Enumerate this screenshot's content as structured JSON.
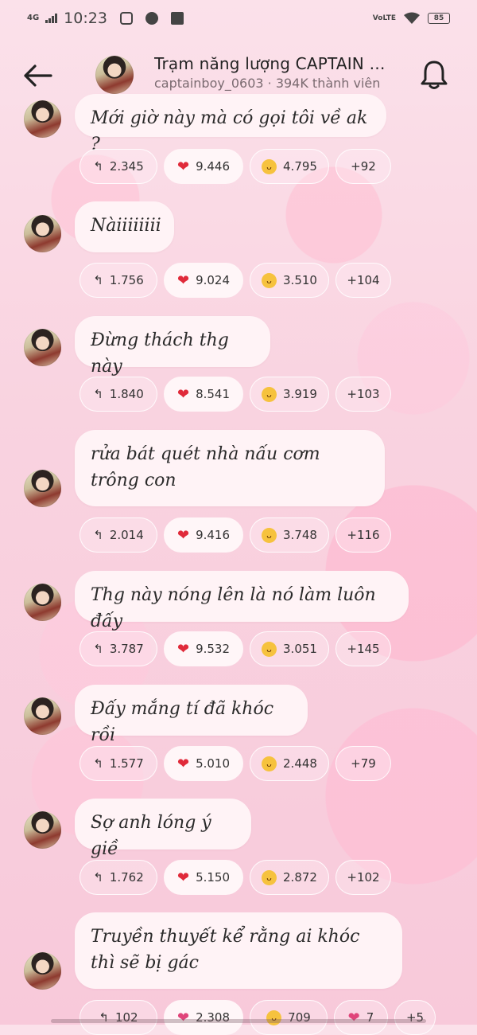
{
  "status_bar": {
    "network": "4G",
    "time": "10:23",
    "volte": "VoLTE",
    "battery": "85"
  },
  "header": {
    "title": "Trạm năng lượng CAPTAIN BO...",
    "subtitle": "captainboy_0603 · 394K thành viên"
  },
  "messages": [
    {
      "text": "Mới giờ này mà có gọi tôi về ak ?",
      "reactions": {
        "replies": "2.345",
        "hearts": "9.446",
        "laughs": "4.795",
        "more": "+92"
      }
    },
    {
      "text": "Nàiiiiiiii",
      "reactions": {
        "replies": "1.756",
        "hearts": "9.024",
        "laughs": "3.510",
        "more": "+104"
      }
    },
    {
      "text": "Đừng thách thg này",
      "reactions": {
        "replies": "1.840",
        "hearts": "8.541",
        "laughs": "3.919",
        "more": "+103"
      }
    },
    {
      "text": "rửa bát quét nhà nấu cơm trông con",
      "reactions": {
        "replies": "2.014",
        "hearts": "9.416",
        "laughs": "3.748",
        "more": "+116"
      }
    },
    {
      "text": "Thg này nóng lên là nó làm luôn đấy",
      "reactions": {
        "replies": "3.787",
        "hearts": "9.532",
        "laughs": "3.051",
        "more": "+145"
      }
    },
    {
      "text": "Đấy mắng tí đã khóc rồi",
      "reactions": {
        "replies": "1.577",
        "hearts": "5.010",
        "laughs": "2.448",
        "more": "+79"
      }
    },
    {
      "text": "Sợ anh lóng ý giề",
      "reactions": {
        "replies": "1.762",
        "hearts": "5.150",
        "laughs": "2.872",
        "more": "+102"
      }
    },
    {
      "text": "Truyền thuyết kể rằng ai khóc thì sẽ bị gác",
      "reactions": {
        "replies": "102",
        "hearts": "2.308",
        "laughs": "709",
        "sparkle_hearts": "7",
        "more": "+5"
      }
    }
  ],
  "colors": {
    "heart": "#e02a3a",
    "bubble_bg": "#fff3f6",
    "background": "#f9d3e0"
  },
  "icons": [
    "back-arrow-icon",
    "bell-icon",
    "reply-icon",
    "heart-icon",
    "laugh-emoji-icon",
    "sparkle-heart-icon"
  ]
}
